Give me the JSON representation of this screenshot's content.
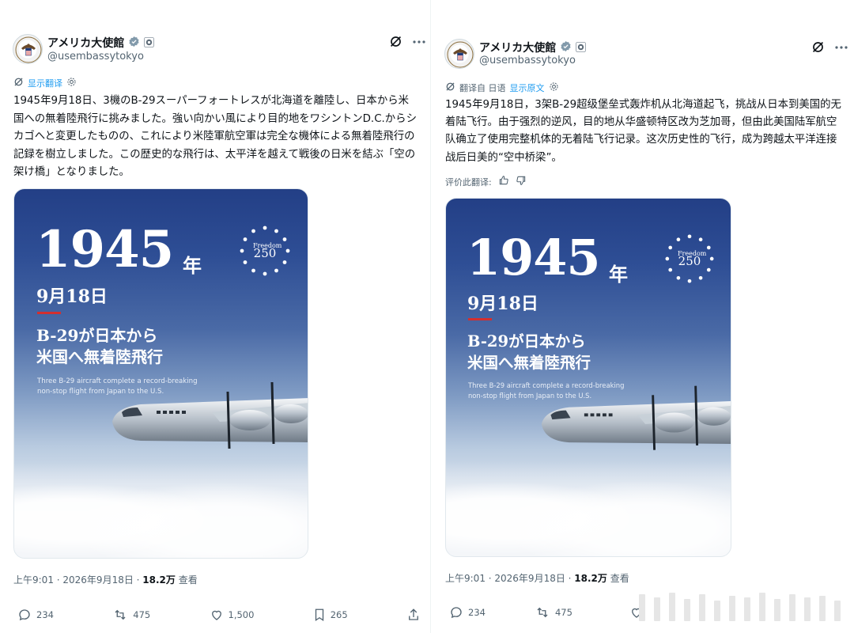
{
  "left": {
    "author": {
      "display_name": "アメリカ大使館",
      "handle": "@usembassytokyo"
    },
    "translate": {
      "link": "显示翻译"
    },
    "text": "1945年9月18日、3機のB-29スーパーフォートレスが北海道を離陸し、日本から米国への無着陸飛行に挑みました。強い向かい風により目的地をワシントンD.C.からシカゴへと変更したものの、これにより米陸軍航空軍は完全な機体による無着陸飛行の記録を樹立しました。この歴史的な飛行は、太平洋を越えて戦後の日米を結ぶ「空の架け橋」となりました。",
    "image": {
      "year": "1945",
      "year_suffix": "年",
      "date": "9月18日",
      "headline_1": "B-29が日本から",
      "headline_2": "米国へ無着陸飛行",
      "sub_1": "Three B-29 aircraft complete a record-breaking",
      "sub_2": "non-stop flight from Japan to the U.S.",
      "badge_word": "Freedom",
      "badge_num": "250"
    },
    "meta": {
      "time": "上午9:01 · 2026年9月18日 · ",
      "views": "18.2万",
      "views_label": " 查看"
    },
    "actions": {
      "replies": "234",
      "reposts": "475",
      "likes": "1,500",
      "bookmarks": "265"
    }
  },
  "right": {
    "author": {
      "display_name": "アメリカ大使館",
      "handle": "@usembassytokyo"
    },
    "translate": {
      "label": "翻译自 日语",
      "link": "显示原文"
    },
    "text": "1945年9月18日，3架B-29超级堡垒式轰炸机从北海道起飞，挑战从日本到美国的无着陆飞行。由于强烈的逆风，目的地从华盛顿特区改为芝加哥，但由此美国陆军航空队确立了使用完整机体的无着陆飞行记录。这次历史性的飞行，成为跨越太平洋连接战后日美的“空中桥梁”。",
    "rate": {
      "label": "评价此翻译:"
    },
    "image": {
      "year": "1945",
      "year_suffix": "年",
      "date": "9月18日",
      "headline_1": "B-29が日本から",
      "headline_2": "米国へ無着陸飛行",
      "sub_1": "Three B-29 aircraft complete a record-breaking",
      "sub_2": "non-stop flight from Japan to the U.S.",
      "badge_word": "Freedom",
      "badge_num": "250"
    },
    "meta": {
      "time": "上午9:01 · 2026年9月18日 · ",
      "views": "18.2万",
      "views_label": " 查看"
    },
    "actions": {
      "replies": "234",
      "reposts": "475"
    }
  },
  "colors": {
    "accent": "#1d9bf0",
    "text": "#0f1419",
    "muted": "#536471",
    "red": "#d32f2f",
    "image_top": "#233f86"
  },
  "icons": [
    "verified-badge-icon",
    "grok-icon",
    "more-icon",
    "translate-icon",
    "settings-icon",
    "thumbs-up-icon",
    "thumbs-down-icon",
    "reply-icon",
    "repost-icon",
    "like-icon",
    "bookmark-icon",
    "share-icon"
  ]
}
